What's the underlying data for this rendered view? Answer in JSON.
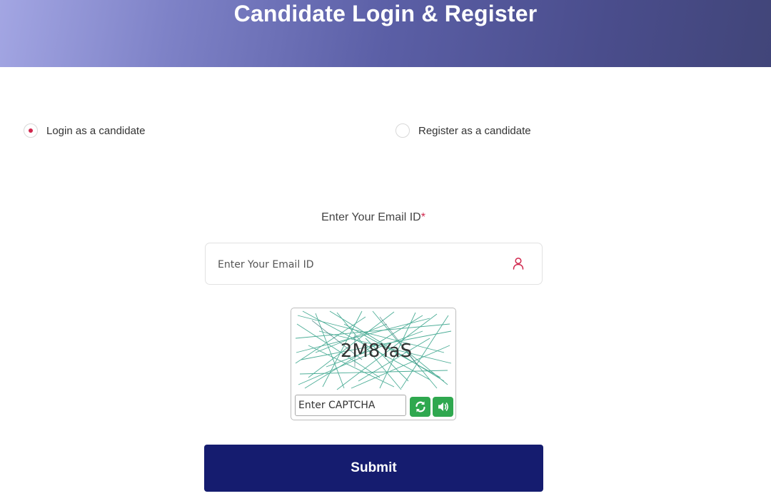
{
  "header": {
    "title": "Candidate Login & Register"
  },
  "mode_options": [
    {
      "label": "Login as a candidate",
      "selected": true
    },
    {
      "label": "Register as a candidate",
      "selected": false
    }
  ],
  "email": {
    "label": "Enter Your Email ID",
    "required_mark": "*",
    "placeholder": "Enter Your Email ID",
    "value": "",
    "icon": "user-icon"
  },
  "captcha": {
    "code": "2M8YaS",
    "placeholder": "Enter CAPTCHA",
    "value": "",
    "refresh_icon": "refresh-icon",
    "audio_icon": "speaker-icon",
    "button_color": "#2fa84f"
  },
  "submit_label": "Submit",
  "colors": {
    "accent": "#d0274d",
    "submit_bg": "#151c6f",
    "header_start": "#a3a6e3",
    "header_end": "#414579"
  }
}
